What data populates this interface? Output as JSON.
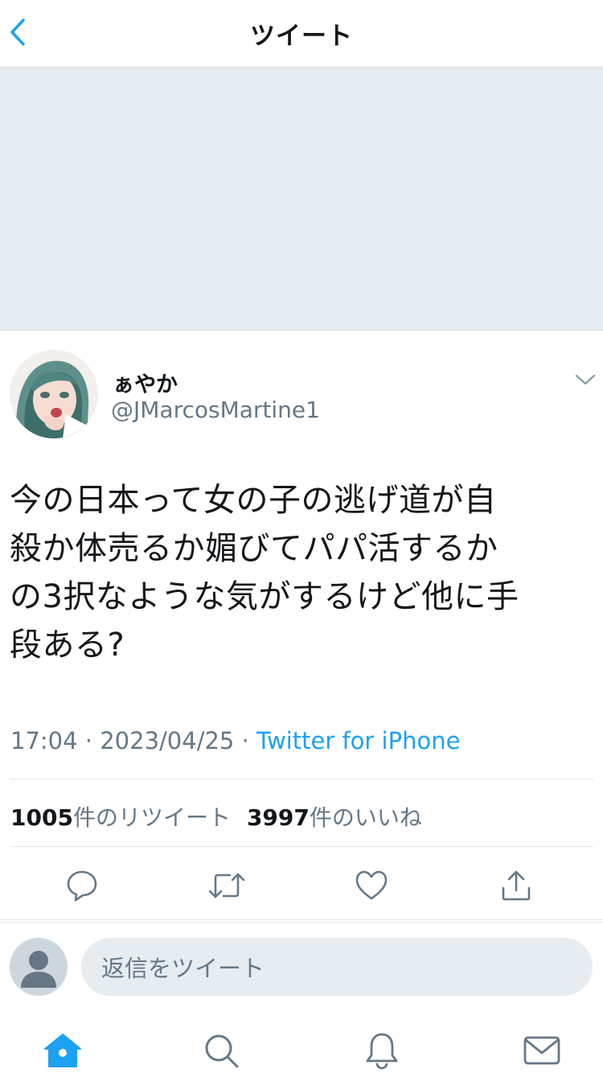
{
  "header": {
    "title": "ツイート",
    "back_icon": "chevron-left-icon"
  },
  "tweet": {
    "author": {
      "display_name": "ぁやか",
      "username": "@JMarcosMartine1"
    },
    "text_lines": [
      "今の日本って女の子の逃げ道が自",
      "殺か体売るか媚びてパパ活するか",
      "の3択なような気がするけど他に手",
      "段ある?"
    ],
    "time": "17:04",
    "date": "2023/04/25",
    "separator": "·",
    "source": "Twitter for iPhone",
    "stats": {
      "retweet_count": "1005",
      "retweet_label": "件のリツイート",
      "like_count": "3997",
      "like_label": "件のいいね"
    }
  },
  "reply": {
    "placeholder": "返信をツイート"
  },
  "colors": {
    "accent": "#1da1f2",
    "secondary_text": "#657786",
    "media_placeholder": "#e6ecf0"
  },
  "icons": {
    "actions": [
      "reply-icon",
      "retweet-icon",
      "like-icon",
      "share-icon"
    ],
    "tabs": [
      "home-icon",
      "search-icon",
      "notifications-icon",
      "messages-icon"
    ]
  }
}
